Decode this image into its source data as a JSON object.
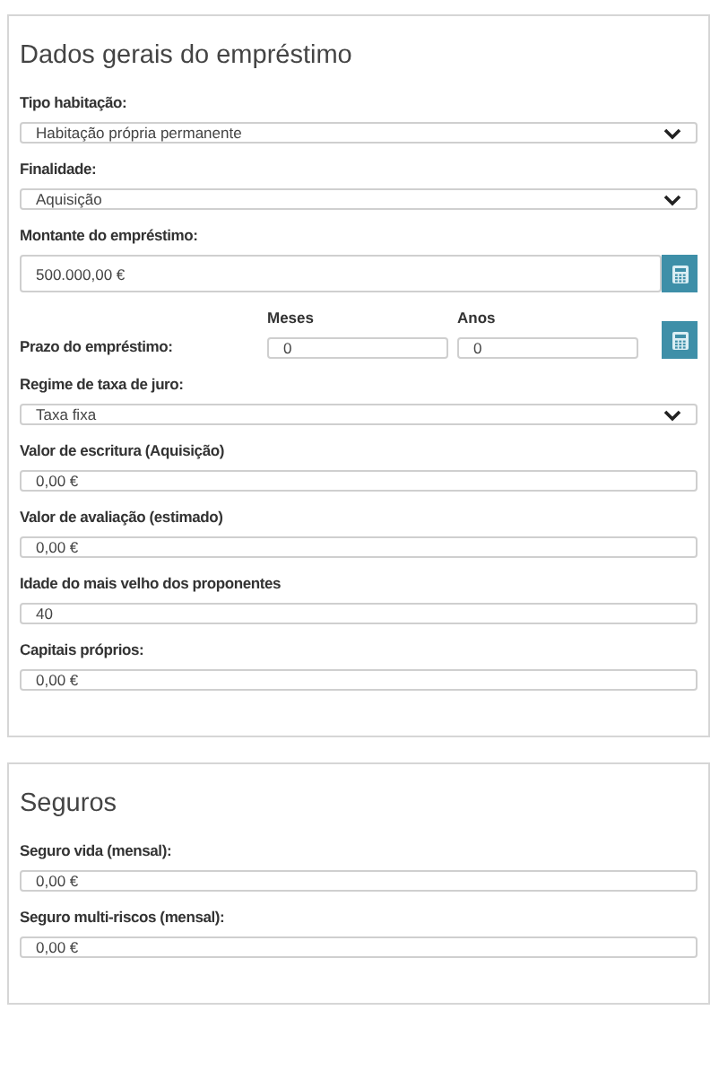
{
  "sections": [
    {
      "title": "Dados gerais do empréstimo",
      "fields": [
        {
          "kind": "select",
          "label": "Tipo habitação:",
          "value": "Habitação própria permanente"
        },
        {
          "kind": "select",
          "label": "Finalidade:",
          "value": "Aquisição"
        },
        {
          "kind": "button_input",
          "label": "Montante do empréstimo:",
          "value": "500.000,00 €"
        },
        {
          "kind": "term",
          "label": "Prazo do empréstimo:",
          "parts": [
            {
              "label": "Meses",
              "value": "0"
            },
            {
              "label": "Anos",
              "value": "0"
            }
          ]
        },
        {
          "kind": "select",
          "label": "Regime de taxa de juro:",
          "value": "Taxa fixa"
        },
        {
          "kind": "input",
          "label": "Valor de escritura (Aquisição)",
          "value": "0,00 €"
        },
        {
          "kind": "input",
          "label": "Valor de avaliação (estimado)",
          "value": "0,00 €"
        },
        {
          "kind": "input",
          "label": "Idade do mais velho dos proponentes",
          "value": "40"
        },
        {
          "kind": "input",
          "label": "Capitais próprios:",
          "value": "0,00 €"
        }
      ]
    },
    {
      "title": "Seguros",
      "fields": [
        {
          "kind": "input",
          "label": "Seguro vida (mensal):",
          "value": "0,00 €"
        },
        {
          "kind": "input",
          "label": "Seguro multi-riscos (mensal):",
          "value": "0,00 €"
        }
      ]
    }
  ]
}
